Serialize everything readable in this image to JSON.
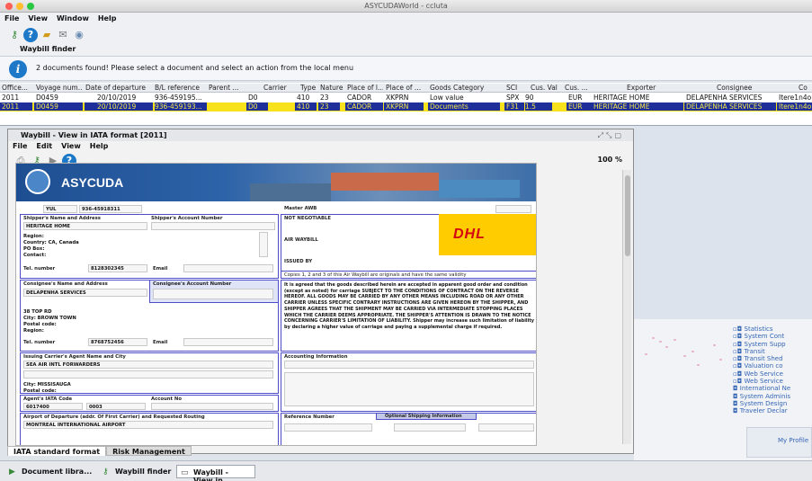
{
  "window": {
    "title": "ASYCUDAWorld - ccluta"
  },
  "menu": [
    "File",
    "View",
    "Window",
    "Help"
  ],
  "toolbar": {
    "icons": [
      "key-icon",
      "help-icon",
      "folder-icon",
      "mail-icon",
      "globe-icon"
    ]
  },
  "finder": {
    "title": "Waybill finder"
  },
  "info": {
    "message": "2 documents found! Please select a document and select an action from the local menu"
  },
  "results": {
    "headers": [
      "Office...",
      "Voyage num...",
      "Date of departure",
      "B/L reference",
      "Parent ...",
      "Carrier",
      "Type",
      "Nature",
      "Place of l...",
      "Place of ...",
      "Goods Category",
      "SCI",
      "Cus. Val",
      "Cus. ...",
      "Exporter",
      "Consignee",
      "Co"
    ],
    "rows": [
      [
        "2011",
        "D0459",
        "20/10/2019",
        "936-459195...",
        "",
        "D0",
        "410",
        "23",
        "CADOR",
        "XKPRN",
        "Low value",
        "SPX",
        "90",
        "EUR",
        "HERITAGE HOME",
        "DELAPENHA SERVICES",
        "Itere1n4o"
      ],
      [
        "2011",
        "D0459",
        "20/10/2019",
        "936-459193...",
        "",
        "D0",
        "410",
        "23",
        "CADOR",
        "XKPRN",
        "Documents",
        "F31",
        "1.5",
        "EUR",
        "HERITAGE HOME",
        "DELAPENHA SERVICES",
        "Itere1n4o"
      ]
    ]
  },
  "internal": {
    "title": "Waybill - View in IATA format [2011]",
    "menu": [
      "File",
      "Edit",
      "View",
      "Help"
    ],
    "zoom": "100 %",
    "tabs": [
      "IATA standard format",
      "Risk Management"
    ]
  },
  "doc": {
    "banner": "ASYCUDA",
    "awb_prefix": "YUL",
    "awb_number": "936-45918311",
    "master_awb_label": "Master AWB",
    "shipper_label": "Shipper's Name and Address",
    "shipper_acct_label": "Shipper's Account Number",
    "shipper_name": "HERITAGE HOME",
    "shipper_region": "Region:",
    "shipper_country": "Country: CA, Canada",
    "shipper_pobox": "PO Box:",
    "shipper_contact": "Contact:",
    "tel_label": "Tel. number",
    "shipper_tel": "8128302345",
    "email_label": "Email",
    "not_negotiable": "NOT NEGOTIABLE",
    "air_waybill": "AIR WAYBILL",
    "issued_by": "ISSUED BY",
    "dhl": "DHL",
    "copies_text": "Copies 1, 2 and 3 of this Air Waybill are originals and have the same validity",
    "consignee_label": "Consignee's Name and Address",
    "consignee_acct_label": "Consignee's Account Number",
    "consignee_name": "DELAPENHA SERVICES",
    "consignee_addr": "38 TOP RD",
    "consignee_city": "City: BROWN TOWN",
    "consignee_postal": "Postal code:",
    "consignee_region": "Region:",
    "consignee_tel": "8768752456",
    "conditions": "It is agreed that the goods described herein are accepted in apparent good order and condition (except as noted) for carriage SUBJECT TO THE CONDITIONS OF CONTRACT ON THE REVERSE HEREOF. ALL GOODS MAY BE CARRIED BY ANY OTHER MEANS INCLUDING ROAD OR ANY OTHER CARRIER UNLESS SPECIFIC CONTRARY INSTRUCTIONS ARE GIVEN HEREON BY THE SHIPPER, AND SHIPPER AGREES THAT THE SHIPMENT MAY BE CARRIED VIA INTERMEDIATE STOPPING PLACES WHICH THE CARRIER DEEMS APPROPRIATE. THE SHIPPER'S ATTENTION IS DRAWN TO THE NOTICE CONCERNING CARRIER'S LIMITATION OF LIABILITY. Shipper may increase such limitation of liability by declaring a higher value of carriage and paying a supplemental charge if required.",
    "agent_label": "Issuing Carrier's Agent Name and City",
    "agent_name": "SEA AIR INTL FORWARDERS",
    "agent_city": "City: MISSISAUGA",
    "agent_postal": "Postal code:",
    "accounting_label": "Accounting Information",
    "iata_code_label": "Agent's IATA Code",
    "iata_code": "6017400",
    "iata_code2": "0003",
    "account_no_label": "Account No",
    "airport_label": "Airport of Departure (addr. Of First Carrier) and Requested Routing",
    "airport": "MONTREAL INTERNATIONAL AIRPORT",
    "reference_label": "Reference Number",
    "optional_label": "Optional Shipping Information"
  },
  "sidepanel": {
    "tree": [
      "Statistics",
      "System Cont",
      "System Supp",
      "Transit",
      "Transit Shed",
      "Valuation co",
      "Web Service",
      "Web Service",
      "International Ne",
      "System Adminis",
      "System Design",
      "Traveler Declar"
    ],
    "profile": "My Profile"
  },
  "taskbar": [
    {
      "label": "Document libra...",
      "icon": "document-library-icon"
    },
    {
      "label": "Waybill finder",
      "icon": "key-icon"
    },
    {
      "label": "Waybill - View in...",
      "icon": "document-icon"
    }
  ]
}
